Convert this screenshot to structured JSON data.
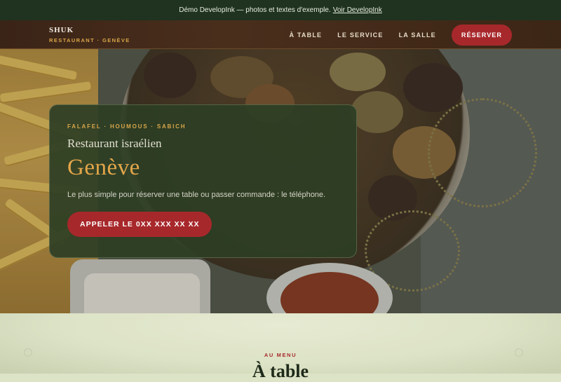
{
  "banner": {
    "text": "Démo DevelopInk — photos et textes d'exemple.",
    "link": "Voir DevelopInk"
  },
  "nav": {
    "brand_title": "SHUK",
    "brand_sub": "RESTAURANT · GENÈVE",
    "links": [
      "À TABLE",
      "LE SERVICE",
      "LA SALLE"
    ],
    "cta": "RÉSERVER"
  },
  "hero": {
    "kicker": "FALAFEL · HOUMOUS · SABICH",
    "subtitle": "Restaurant israélien",
    "title": "Genève",
    "description": "Le plus simple pour réserver une table ou passer commande : le téléphone.",
    "call_button": "APPELER LE 0XX XXX XX XX"
  },
  "menu": {
    "kicker": "AU MENU",
    "title": "À table"
  },
  "colors": {
    "brand_red": "#a7282b",
    "accent_gold": "#d9a64a",
    "dark_green": "#1f3320"
  }
}
